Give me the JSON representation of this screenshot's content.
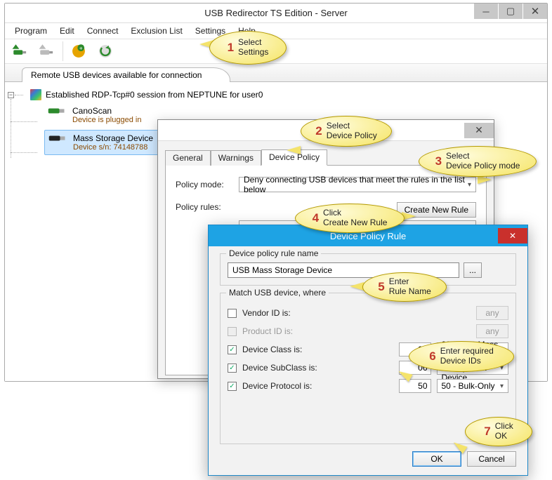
{
  "window": {
    "title": "USB Redirector TS Edition - Server",
    "menubar": [
      "Program",
      "Edit",
      "Connect",
      "Exclusion List",
      "Settings",
      "Help"
    ],
    "main_tab": "Remote USB devices available for connection",
    "tree": {
      "session": "Established RDP-Tcp#0 session from NEPTUNE for user0",
      "dev1_name": "CanoScan",
      "dev1_sub": "Device is plugged in",
      "dev2_name": "Mass Storage Device",
      "dev2_sub": "Device s/n: 74148788"
    }
  },
  "settings": {
    "tabs": {
      "general": "General",
      "warnings": "Warnings",
      "policy": "Device Policy"
    },
    "policy_mode_label": "Policy mode:",
    "policy_mode_value": "Deny connecting USB devices that meet the rules in the list below",
    "policy_rules_label": "Policy rules:",
    "create_rule_btn": "Create New Rule"
  },
  "rule": {
    "title": "Device Policy Rule",
    "name_group": "Device policy rule name",
    "name_value": "USB Mass Storage Device",
    "dots": "...",
    "match_group": "Match USB device, where",
    "vendor_label": "Vendor ID is:",
    "product_label": "Product ID is:",
    "class_label": "Device Class is:",
    "subclass_label": "Device SubClass is:",
    "protocol_label": "Device Protocol is:",
    "any": "any",
    "class_val": "08",
    "class_combo": "08 - USB Mass Storage Device",
    "subclass_val": "06",
    "subclass_combo": "06 - SCSI Transparent Device",
    "protocol_val": "50",
    "protocol_combo": "50 - Bulk-Only",
    "ok": "OK",
    "cancel": "Cancel"
  },
  "callouts": {
    "c1": "Select\nSettings",
    "c2": "Select\nDevice Policy",
    "c3": "Select\nDevice Policy mode",
    "c4": "Click\nCreate New Rule",
    "c5": "Enter\nRule Name",
    "c6": "Enter required\nDevice IDs",
    "c7": "Click\nOK"
  }
}
